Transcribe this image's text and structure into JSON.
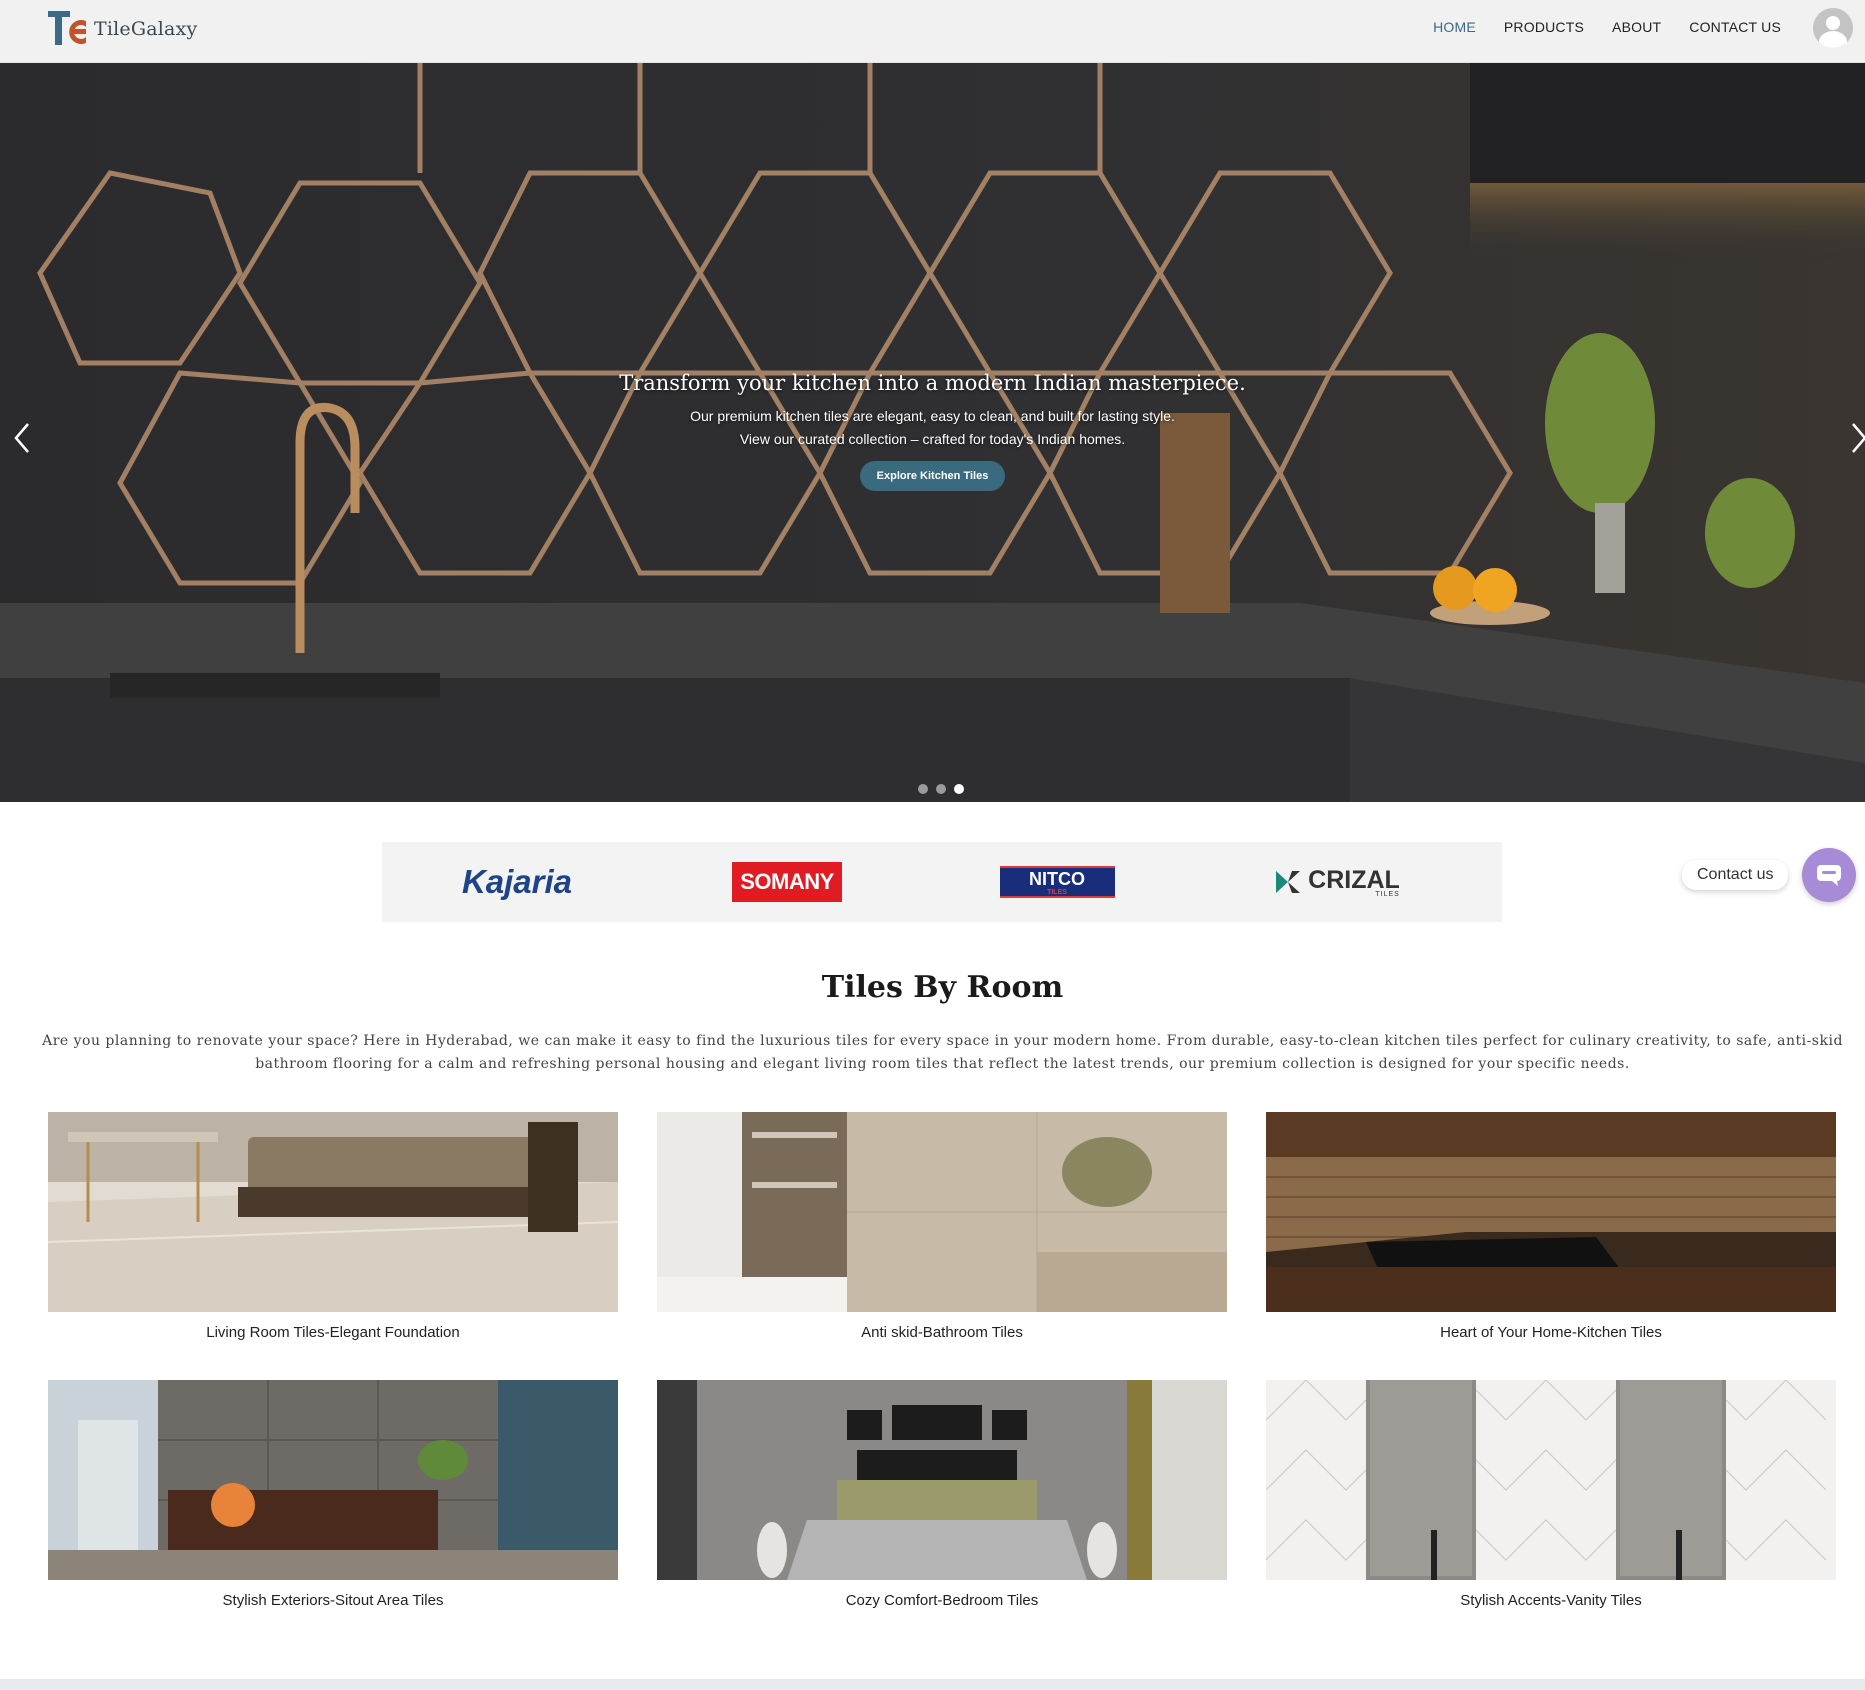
{
  "brand": {
    "name": "TileGalaxy",
    "mark": "TG"
  },
  "nav": [
    {
      "label": "HOME",
      "active": true
    },
    {
      "label": "PRODUCTS",
      "active": false
    },
    {
      "label": "ABOUT",
      "active": false
    },
    {
      "label": "CONTACT US",
      "active": false
    }
  ],
  "hero": {
    "title": "Transform your kitchen into a modern Indian masterpiece.",
    "line1": "Our premium kitchen tiles are elegant, easy to clean, and built for lasting style.",
    "line2": "View our curated collection – crafted for today's Indian homes.",
    "button": "Explore Kitchen Tiles",
    "slides_total": 3,
    "active_slide": 3
  },
  "brands": [
    "Kajaria",
    "SOMANY",
    "NITCO",
    "CRIZAL"
  ],
  "brand_sublabels": {
    "nitco": "TILES",
    "crizal": "TILES"
  },
  "contact_widget": {
    "label": "Contact us"
  },
  "rooms": {
    "title": "Tiles By Room",
    "description": "Are you planning to renovate your space? Here in Hyderabad, we can make it easy to find the luxurious tiles for every space in your modern home. From durable, easy-to-clean kitchen tiles perfect for culinary creativity, to safe, anti-skid bathroom flooring for a calm and refreshing personal housing and elegant living room tiles that reflect the latest trends, our premium collection is designed for your specific needs.",
    "cards": [
      {
        "caption": "Living Room Tiles-Elegant Foundation"
      },
      {
        "caption": "Anti skid-Bathroom Tiles"
      },
      {
        "caption": "Heart of Your Home-Kitchen Tiles"
      },
      {
        "caption": "Stylish Exteriors-Sitout Area Tiles"
      },
      {
        "caption": "Cozy Comfort-Bedroom Tiles"
      },
      {
        "caption": "Stylish Accents-Vanity Tiles"
      }
    ]
  },
  "colors": {
    "accent": "#3a6a7e",
    "nav_active": "#3b6a86",
    "widget": "#a88bd6"
  }
}
